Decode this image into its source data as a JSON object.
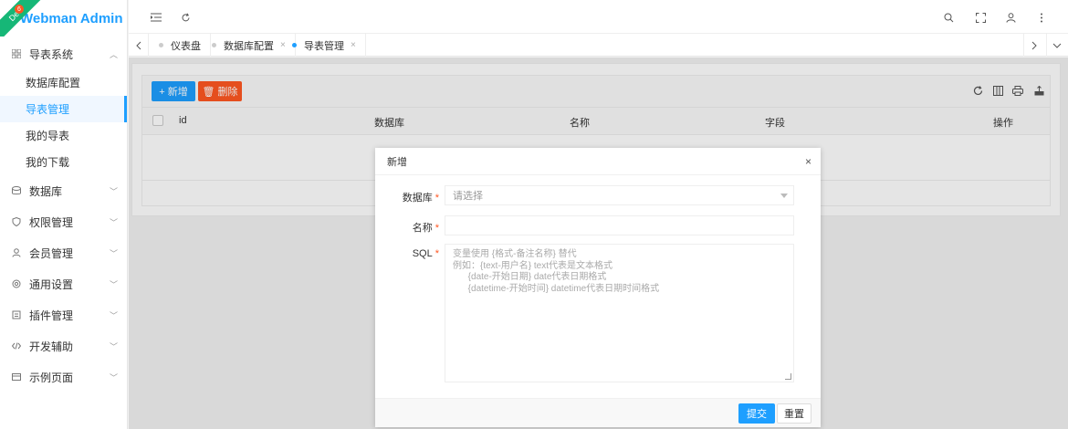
{
  "app": {
    "title": "Webman Admin",
    "env_badge": "Dev",
    "env_count": "6"
  },
  "sidebar": {
    "groups": [
      {
        "label": "导表系统",
        "icon": "grid-icon",
        "expanded": true,
        "items": [
          {
            "label": "数据库配置"
          },
          {
            "label": "导表管理"
          },
          {
            "label": "我的导表"
          },
          {
            "label": "我的下载"
          }
        ]
      },
      {
        "label": "数据库",
        "icon": "database-icon"
      },
      {
        "label": "权限管理",
        "icon": "shield-icon"
      },
      {
        "label": "会员管理",
        "icon": "user-icon"
      },
      {
        "label": "通用设置",
        "icon": "gear-icon"
      },
      {
        "label": "插件管理",
        "icon": "plugin-icon"
      },
      {
        "label": "开发辅助",
        "icon": "code-icon"
      },
      {
        "label": "示例页面",
        "icon": "layout-icon"
      }
    ]
  },
  "tabs": [
    {
      "label": "仪表盘"
    },
    {
      "label": "数据库配置",
      "close": "×"
    },
    {
      "label": "导表管理",
      "close": "×"
    }
  ],
  "toolbar": {
    "add_label": "+ 新增",
    "delete_label": "🗑 删除"
  },
  "table": {
    "columns": [
      "id",
      "数据库",
      "名称",
      "字段",
      "操作"
    ]
  },
  "modal": {
    "title": "新增",
    "close": "×",
    "fields": {
      "database": {
        "label": "数据库",
        "placeholder": "请选择"
      },
      "name": {
        "label": "名称",
        "value": ""
      },
      "sql": {
        "label": "SQL",
        "placeholder": "变量使用 {格式-备注名称} 替代\n例如：{text-用户名} text代表是文本格式\n      {date-开始日期} date代表日期格式\n      {datetime-开始时间} datetime代表日期时间格式"
      }
    },
    "submit_label": "提交",
    "reset_label": "重置",
    "required_mark": "*"
  },
  "colors": {
    "primary": "#1E9FFF",
    "danger": "#FF5722",
    "ribbon": "#16b777"
  }
}
